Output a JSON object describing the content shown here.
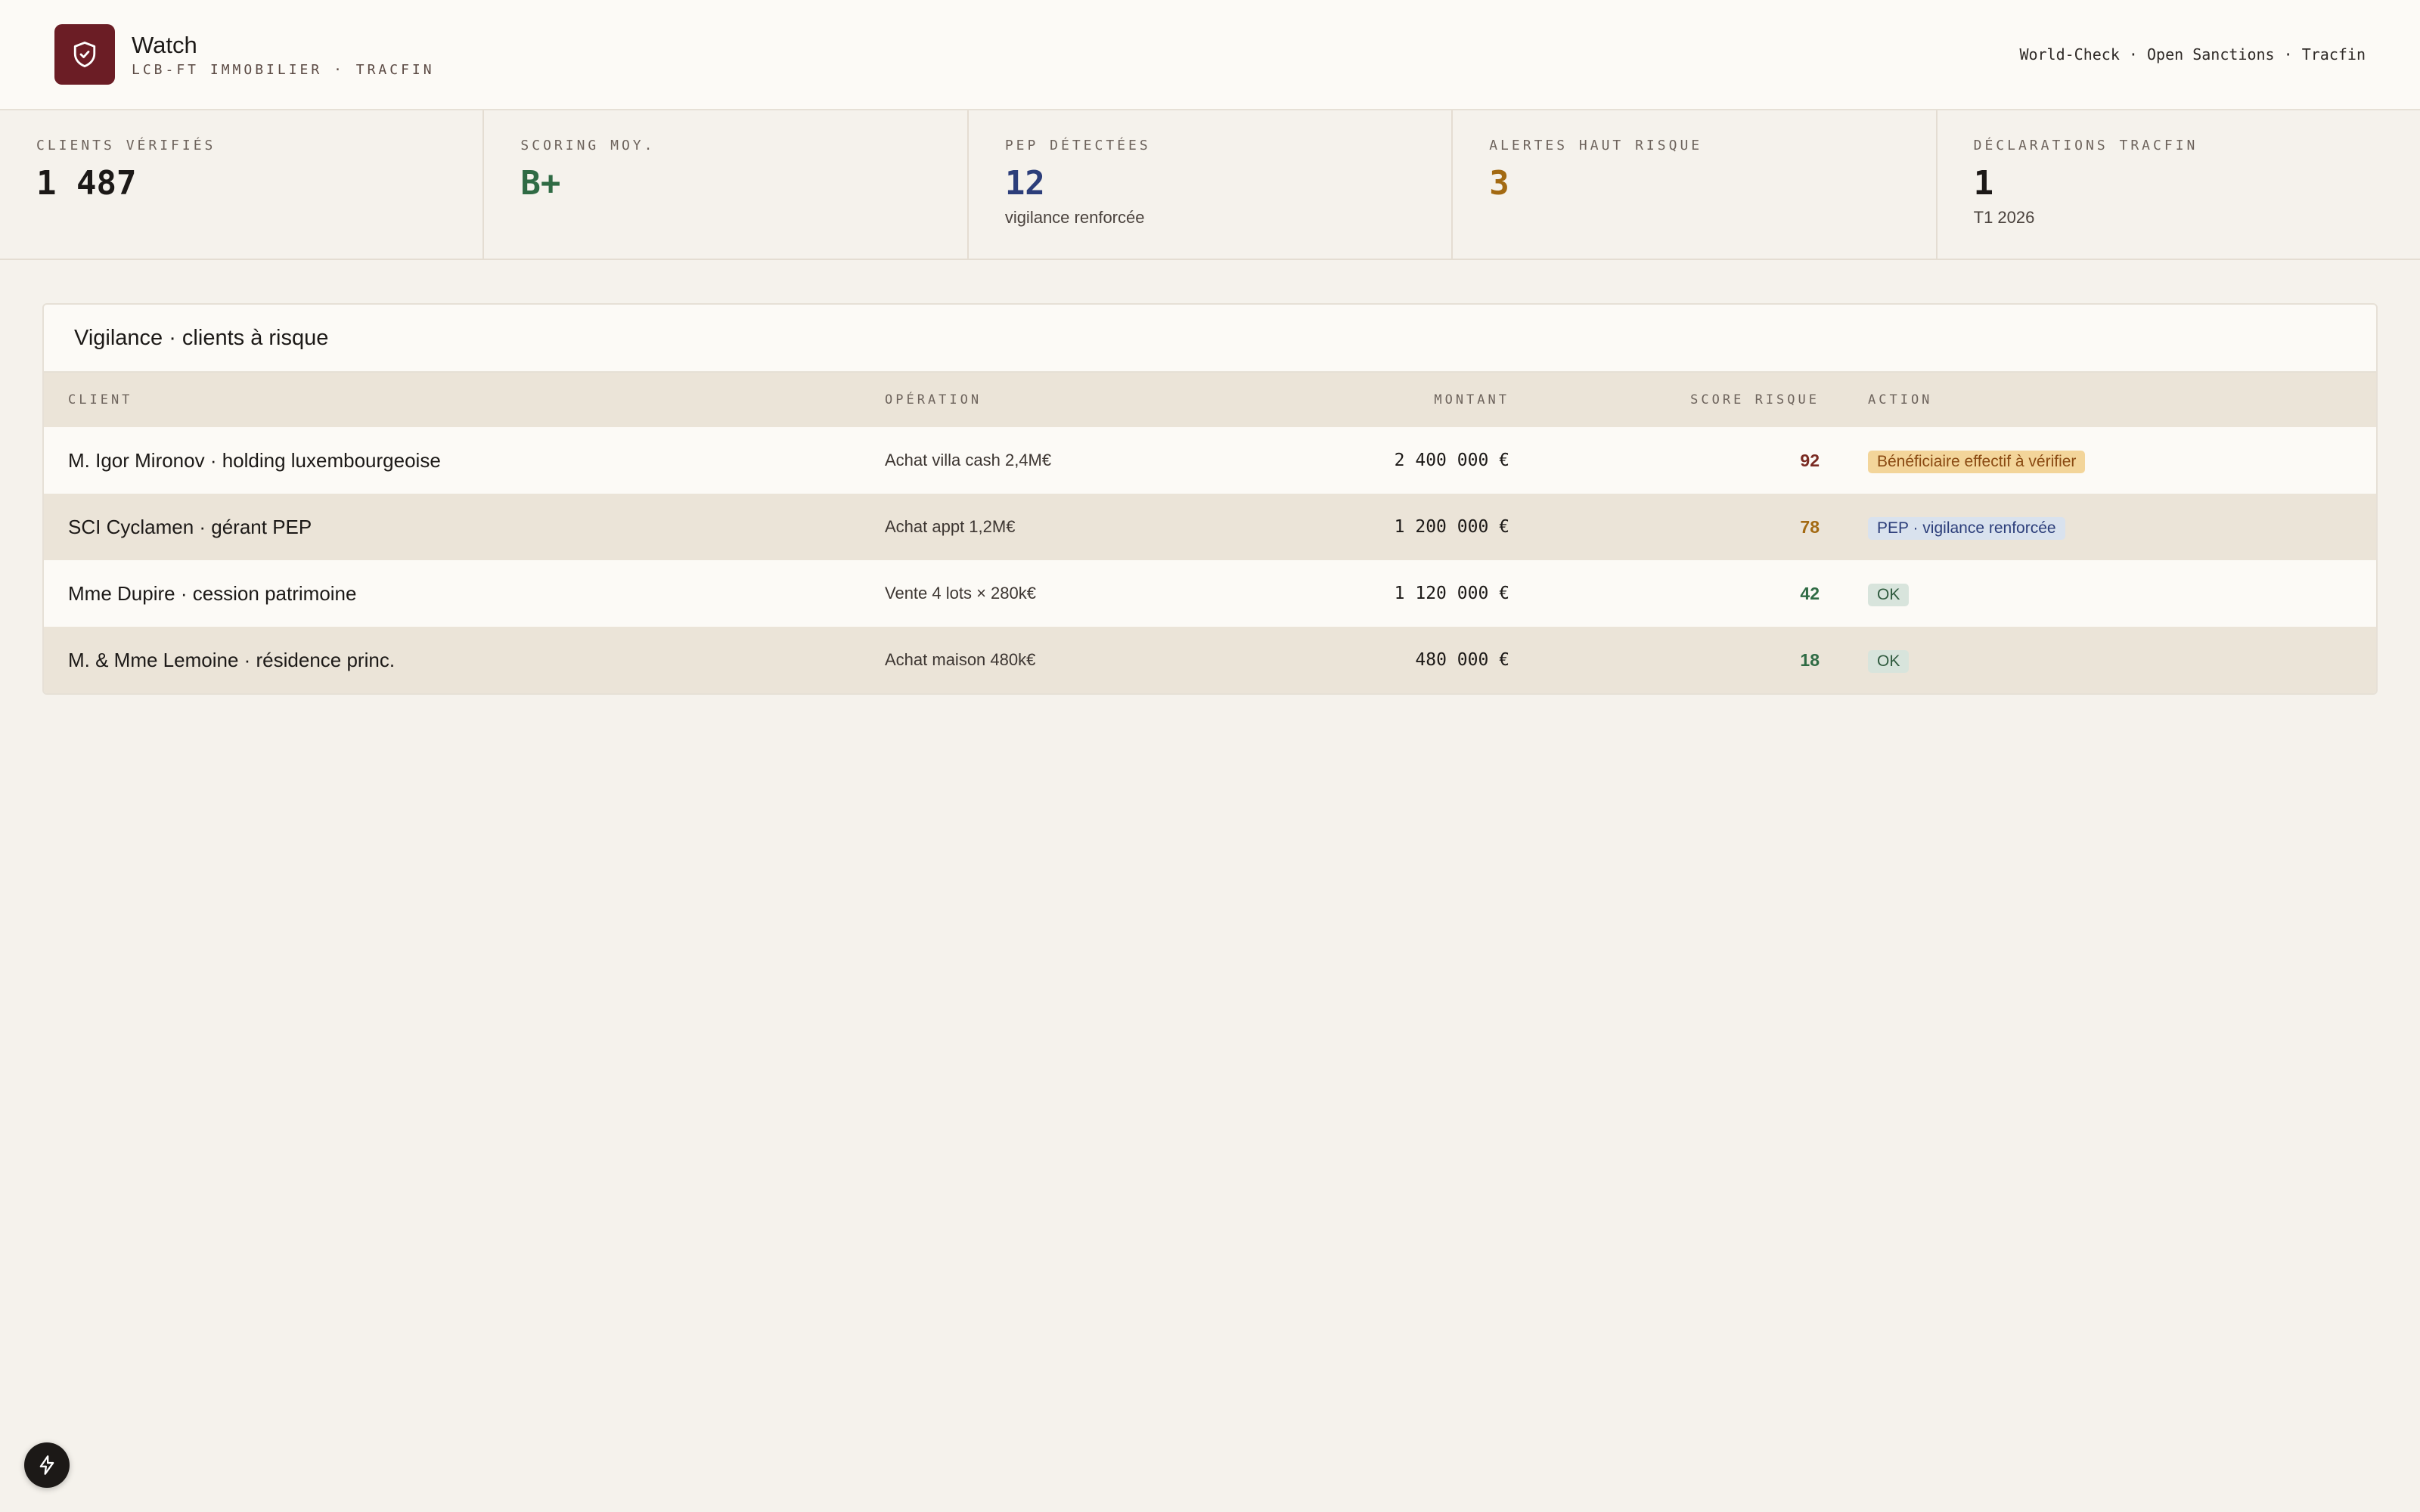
{
  "header": {
    "title": "Watch",
    "subtitle": "LCB-FT IMMOBILIER · TRACFIN",
    "sources": "World-Check · Open Sanctions · Tracfin",
    "logo_icon": "shield-check-icon",
    "logo_color": "#6b1d25"
  },
  "kpis": [
    {
      "label": "CLIENTS VÉRIFIÉS",
      "value": "1 487",
      "sub": "",
      "color": "#1c1917"
    },
    {
      "label": "SCORING MOY.",
      "value": "B+",
      "sub": "",
      "color": "#2f6b44"
    },
    {
      "label": "PEP DÉTECTÉES",
      "value": "12",
      "sub": "vigilance renforcée",
      "color": "#2c3e7a"
    },
    {
      "label": "ALERTES HAUT RISQUE",
      "value": "3",
      "sub": "",
      "color": "#a36a12"
    },
    {
      "label": "DÉCLARATIONS TRACFIN",
      "value": "1",
      "sub": "T1 2026",
      "color": "#1c1917"
    }
  ],
  "table": {
    "title": "Vigilance · clients à risque",
    "columns": {
      "client": "CLIENT",
      "operation": "OPÉRATION",
      "amount": "MONTANT",
      "score": "SCORE RISQUE",
      "action": "ACTION"
    },
    "rows": [
      {
        "client": "M. Igor Mironov · holding luxembourgeoise",
        "operation": "Achat villa cash 2,4M€",
        "amount": "2 400 000 €",
        "score": "92",
        "score_color": "#7a2a22",
        "action": "Bénéficiaire effectif à vérifier",
        "action_bg": "#f3d59a",
        "action_fg": "#8a4a12"
      },
      {
        "client": "SCI Cyclamen · gérant PEP",
        "operation": "Achat appt 1,2M€",
        "amount": "1 200 000 €",
        "score": "78",
        "score_color": "#a36a12",
        "action": "PEP · vigilance renforcée",
        "action_bg": "#d9e2ee",
        "action_fg": "#2c3e7a"
      },
      {
        "client": "Mme Dupire · cession patrimoine",
        "operation": "Vente 4 lots × 280k€",
        "amount": "1 120 000 €",
        "score": "42",
        "score_color": "#2f6b44",
        "action": "OK",
        "action_bg": "#d8e4dc",
        "action_fg": "#2f5a3e"
      },
      {
        "client": "M. & Mme Lemoine · résidence princ.",
        "operation": "Achat maison 480k€",
        "amount": "480 000 €",
        "score": "18",
        "score_color": "#2f6b44",
        "action": "OK",
        "action_bg": "#d8e4dc",
        "action_fg": "#2f5a3e"
      }
    ]
  },
  "fab": {
    "icon": "lightning-bolt-icon"
  }
}
